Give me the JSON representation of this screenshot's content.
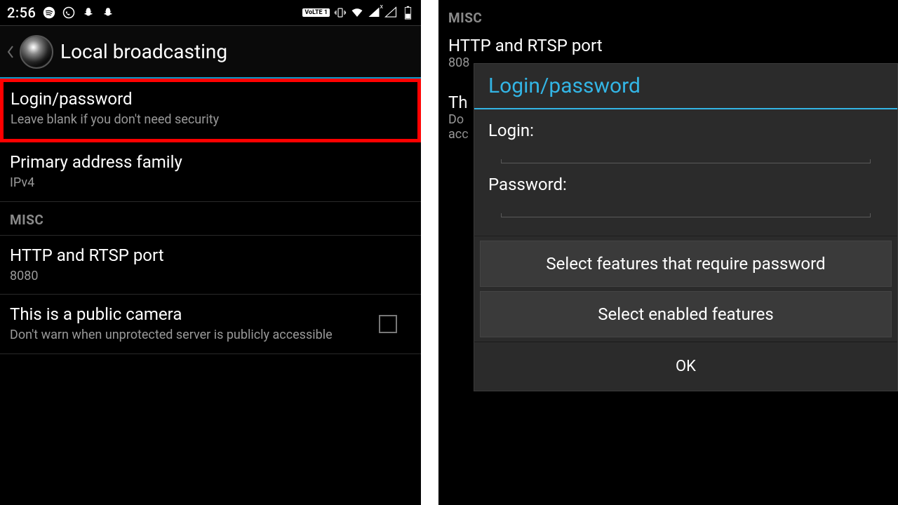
{
  "statusbar": {
    "time": "2:56",
    "volte": "VoLTE 1"
  },
  "header": {
    "title": "Local broadcasting"
  },
  "left": {
    "login": {
      "title": "Login/password",
      "sub": "Leave blank if you don't need security"
    },
    "primary": {
      "title": "Primary address family",
      "sub": "IPv4"
    },
    "misc_header": "MISC",
    "port": {
      "title": "HTTP and RTSP port",
      "sub": "8080"
    },
    "public": {
      "title": "This is a public camera",
      "sub": "Don't warn when unprotected server is publicly accessible"
    }
  },
  "right": {
    "misc_header": "MISC",
    "port": {
      "title": "HTTP and RTSP port",
      "sub": "808"
    },
    "truncated": {
      "title": "Th",
      "sub1": "Do",
      "sub2": "acc"
    }
  },
  "dialog": {
    "title": "Login/password",
    "login_label": "Login:",
    "password_label": "Password:",
    "btn_features_pw": "Select features that require password",
    "btn_features_enabled": "Select enabled features",
    "ok": "OK"
  }
}
